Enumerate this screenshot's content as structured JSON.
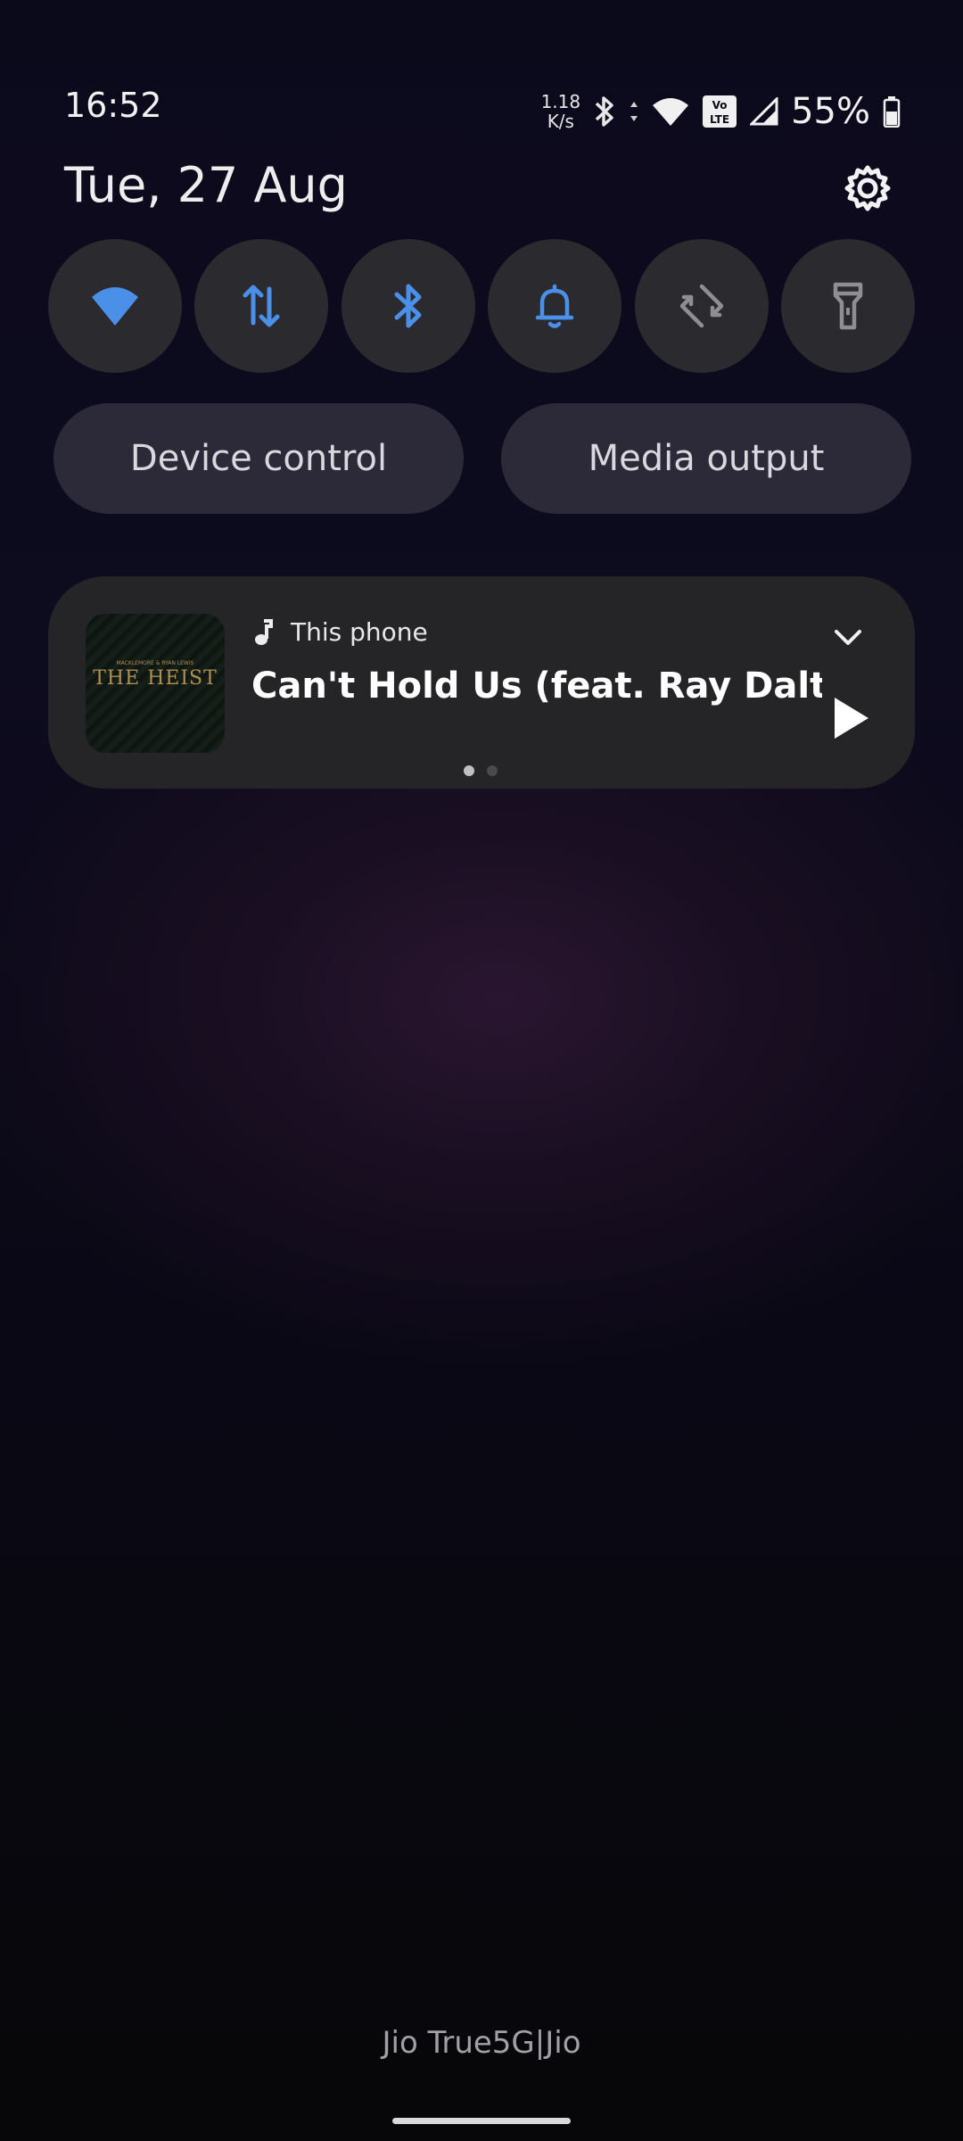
{
  "status_bar": {
    "time": "16:52",
    "net_speed_value": "1.18",
    "net_speed_unit": "K/s",
    "battery_percent": "55%",
    "icons": [
      "bluetooth-icon",
      "data-arrows-icon",
      "wifi-icon",
      "volte-icon",
      "signal-icon",
      "battery-icon"
    ]
  },
  "header": {
    "date": "Tue, 27 Aug",
    "settings_icon": "gear-icon"
  },
  "quick_tiles": [
    {
      "name": "wifi",
      "icon": "wifi-icon",
      "active": true
    },
    {
      "name": "mobile-data",
      "icon": "data-transfer-icon",
      "active": true
    },
    {
      "name": "bluetooth",
      "icon": "bluetooth-icon",
      "active": true
    },
    {
      "name": "sound",
      "icon": "bell-icon",
      "active": true
    },
    {
      "name": "auto-rotate",
      "icon": "rotate-icon",
      "active": false
    },
    {
      "name": "flashlight",
      "icon": "flashlight-icon",
      "active": false
    }
  ],
  "buttons": {
    "device_control": "Device control",
    "media_output": "Media output"
  },
  "media": {
    "source": "This phone",
    "track_title": "Can't Hold Us (feat. Ray Dalt...",
    "album_art_text": "THE HEIST",
    "album_art_subtext": "MACKLEMORE & RYAN LEWIS",
    "page_count": 2,
    "active_page": 1
  },
  "footer": {
    "carrier": "Jio True5G|Jio"
  },
  "colors": {
    "accent": "#4a8fe8",
    "tile_bg": "#2b2b2f",
    "inactive_icon": "#8e8e93"
  }
}
